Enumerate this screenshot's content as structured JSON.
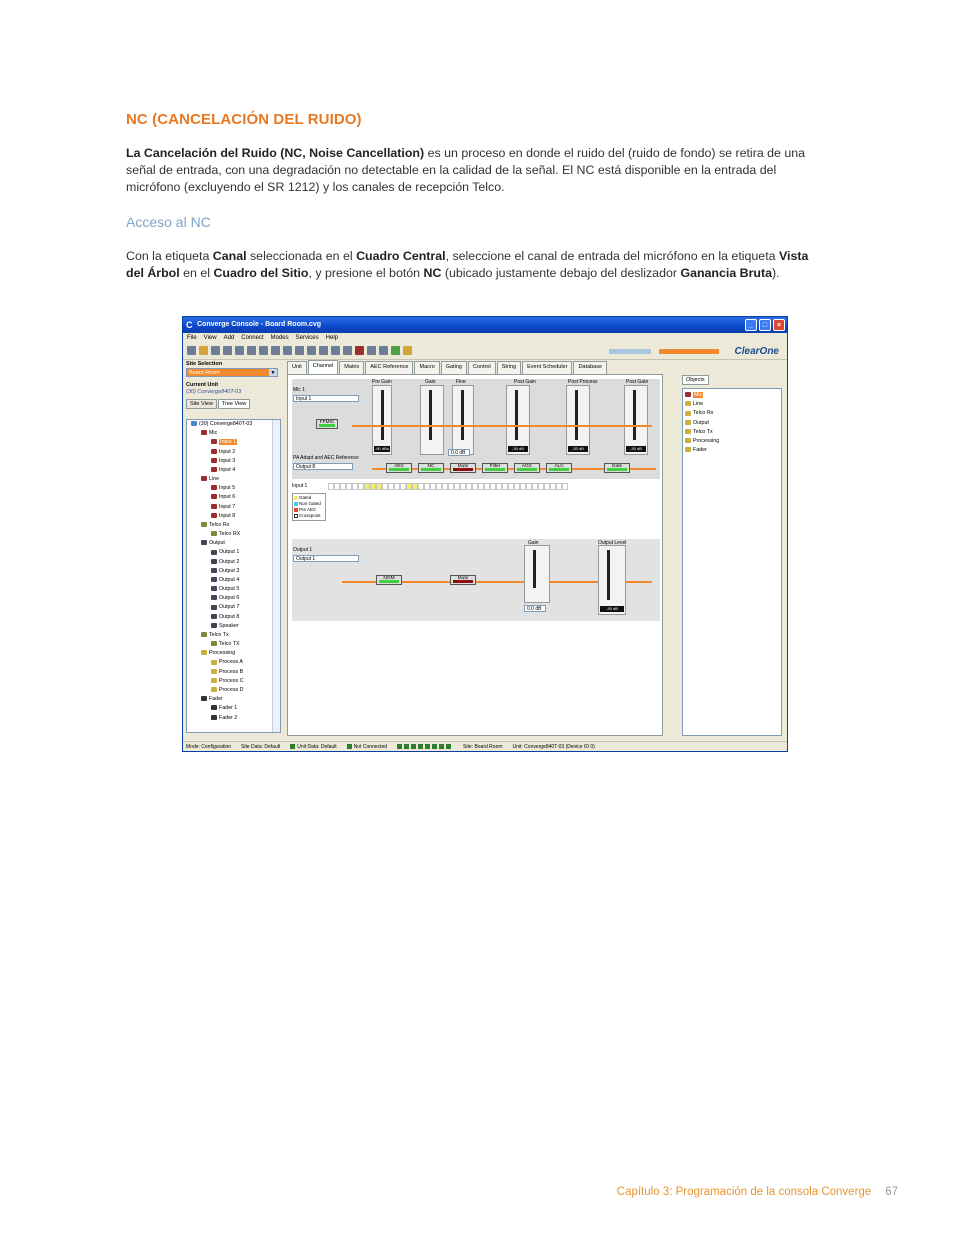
{
  "page": {
    "title": "NC (CANCELACIÓN DEL RUIDO)",
    "p1_b": "La Cancelación del Ruido (NC, Noise Cancellation)",
    "p1_t": " es un proceso en donde el ruido del (ruido de fondo) se retira de una señal de entrada, con una degradación no detectable en la calidad de la señal. El NC está disponible en la entrada del micrófono (excluyendo el SR 1212) y los canales de recepción Telco.",
    "subhead": "Acceso al NC",
    "p2_t1": "Con la etiqueta ",
    "p2_b1": "Canal",
    "p2_t2": " seleccionada en el ",
    "p2_b2": "Cuadro Central",
    "p2_t3": ", seleccione el canal de entrada del micrófono en la etiqueta ",
    "p2_b3": "Vista del Árbol",
    "p2_t4": " en el ",
    "p2_b4": "Cuadro del Sitio",
    "p2_t5": ", y presione el botón ",
    "p2_b5": "NC",
    "p2_t6": " (ubicado justamente debajo del deslizador ",
    "p2_b6": "Ganancia Bruta",
    "p2_t7": ").",
    "footer": "Capítulo 3: Programación de la consola Converge",
    "page_number": "67"
  },
  "app": {
    "title": "Converge Console - Board Room.cvg",
    "menu": [
      "File",
      "View",
      "Add",
      "Connect",
      "Modes",
      "Services",
      "Help"
    ],
    "brand": "ClearOne",
    "site_selection_label": "Site Selection",
    "site_selected": "Board Room",
    "current_unit_label": "Current Unit",
    "current_unit_value": "(30) Converge840T-03",
    "view_tabs": [
      "Site View",
      "Tree View"
    ],
    "tree": [
      {
        "label": "(30) Converge840T-03",
        "icon": "unit",
        "indent": 1
      },
      {
        "label": "Mic",
        "icon": "mic",
        "indent": 2
      },
      {
        "label": "Input 1",
        "icon": "mic",
        "indent": 3,
        "selected": true
      },
      {
        "label": "Input 2",
        "icon": "mic",
        "indent": 3
      },
      {
        "label": "Input 3",
        "icon": "mic",
        "indent": 3
      },
      {
        "label": "Input 4",
        "icon": "mic",
        "indent": 3
      },
      {
        "label": "Line",
        "icon": "mic",
        "indent": 2
      },
      {
        "label": "Input 5",
        "icon": "mic",
        "indent": 3
      },
      {
        "label": "Input 6",
        "icon": "mic",
        "indent": 3
      },
      {
        "label": "Input 7",
        "icon": "mic",
        "indent": 3
      },
      {
        "label": "Input 8",
        "icon": "mic",
        "indent": 3
      },
      {
        "label": "Telco Rx",
        "icon": "grp",
        "indent": 2
      },
      {
        "label": "Telco RX",
        "icon": "grp",
        "indent": 3
      },
      {
        "label": "Output",
        "icon": "spk",
        "indent": 2
      },
      {
        "label": "Output 1",
        "icon": "spk",
        "indent": 3
      },
      {
        "label": "Output 2",
        "icon": "spk",
        "indent": 3
      },
      {
        "label": "Output 3",
        "icon": "spk",
        "indent": 3
      },
      {
        "label": "Output 4",
        "icon": "spk",
        "indent": 3
      },
      {
        "label": "Output 5",
        "icon": "spk",
        "indent": 3
      },
      {
        "label": "Output 6",
        "icon": "spk",
        "indent": 3
      },
      {
        "label": "Output 7",
        "icon": "spk",
        "indent": 3
      },
      {
        "label": "Output 8",
        "icon": "spk",
        "indent": 3
      },
      {
        "label": "Speaker",
        "icon": "spk",
        "indent": 3
      },
      {
        "label": "Telco Tx",
        "icon": "grp",
        "indent": 2
      },
      {
        "label": "Telco TX",
        "icon": "grp",
        "indent": 3
      },
      {
        "label": "Processing",
        "icon": "proc",
        "indent": 2
      },
      {
        "label": "Process A",
        "icon": "proc",
        "indent": 3
      },
      {
        "label": "Process B",
        "icon": "proc",
        "indent": 3
      },
      {
        "label": "Process C",
        "icon": "proc",
        "indent": 3
      },
      {
        "label": "Process D",
        "icon": "proc",
        "indent": 3
      },
      {
        "label": "Fader",
        "icon": "fad",
        "indent": 2
      },
      {
        "label": "Fader 1",
        "icon": "fad",
        "indent": 3
      },
      {
        "label": "Fader 2",
        "icon": "fad",
        "indent": 3
      }
    ],
    "tabs": [
      "Unit",
      "Channel",
      "Matrix",
      "AEC Reference",
      "Macro",
      "Gating",
      "Control",
      "String",
      "Event Scheduler",
      "Database"
    ],
    "active_tab": "Channel",
    "channel": {
      "mic_label": "Mic 1",
      "mic_value": "Input 1",
      "ffmic": "FFMIC",
      "pa_label": "PA Adapt and AEC Reference",
      "pa_value": "Output 8",
      "pre_gain": "Pre Gain",
      "gain": "Gain",
      "fine": "Fine",
      "post_gain": "Post Gain",
      "post_process": "Post Process",
      "post_gate": "Post Gate",
      "readout_1": "-80 dBu",
      "readout_fine": "0.0 dB",
      "readout_2": "-30 dB",
      "readout_3": "-30 dB",
      "readout_4": "-30 dB",
      "buttons": [
        "AEC",
        "NC",
        "Mute",
        "Filter",
        "AGC",
        "ALC",
        "Gate"
      ],
      "input_label": "Input 1",
      "legend": [
        "Gated",
        "Non Gated",
        "Pre AEC",
        "Crosspoint"
      ],
      "output_label": "Output 1",
      "output_value": "Output 1",
      "nom": "NOM",
      "out_mute": "Mute",
      "out_gain": "Gain",
      "output_level": "Output Level",
      "out_gain_readout": "0.0 dB",
      "out_level_readout": "-30 dB"
    },
    "objects_btn": "Objects",
    "objects": [
      "Mic",
      "Line",
      "Telco Rx",
      "Output",
      "Telco Tx",
      "Processing",
      "Fader"
    ],
    "status": {
      "mode": "Mode: Configuration",
      "site_data": "Site Data: Default",
      "unit_data": "Unit Data: Default",
      "connected": "Not Connected",
      "site": "Site: Board Room",
      "unit": "Unit: Converge840T-03 (Device ID 0)"
    }
  }
}
